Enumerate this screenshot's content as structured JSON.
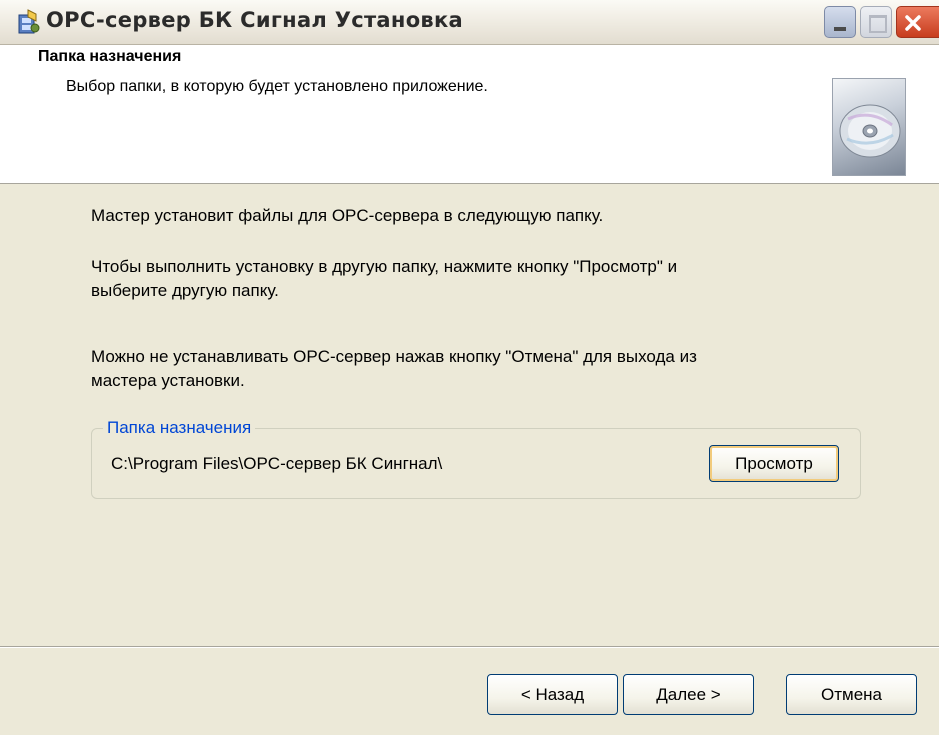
{
  "window": {
    "title": "OPC-сервер БК Сигнал Установка",
    "icons": {
      "app": "installer-icon",
      "minimize": "minimize-icon",
      "maximize": "maximize-icon",
      "close": "close-icon",
      "banner": "cd-disc-icon"
    },
    "colors": {
      "accent": "#0046d5",
      "close_button": "#d9522f",
      "dialog_background": "#ece9d8"
    }
  },
  "header": {
    "title": "Папка назначения",
    "subtitle": "Выбор папки, в которую будет установлено приложение."
  },
  "body": {
    "para1": "Мастер установит файлы для OPC-сервера  в следующую папку.",
    "para2_line1": "Чтобы выполнить установку в другую папку, нажмите кнопку \"Просмотр\" и",
    "para2_line2": "выберите другую папку.",
    "para3_line1": "Можно не устанавливать OPC-сервер нажав кнопку \"Отмена\" для выхода из",
    "para3_line2": "мастера установки."
  },
  "destination": {
    "legend": "Папка назначения",
    "path": "C:\\Program Files\\OPC-сервер БК Сингнал\\",
    "browse_label": "Просмотр"
  },
  "footer": {
    "back_label": "< Назад",
    "next_label": "Далее >",
    "cancel_label": "Отмена"
  }
}
